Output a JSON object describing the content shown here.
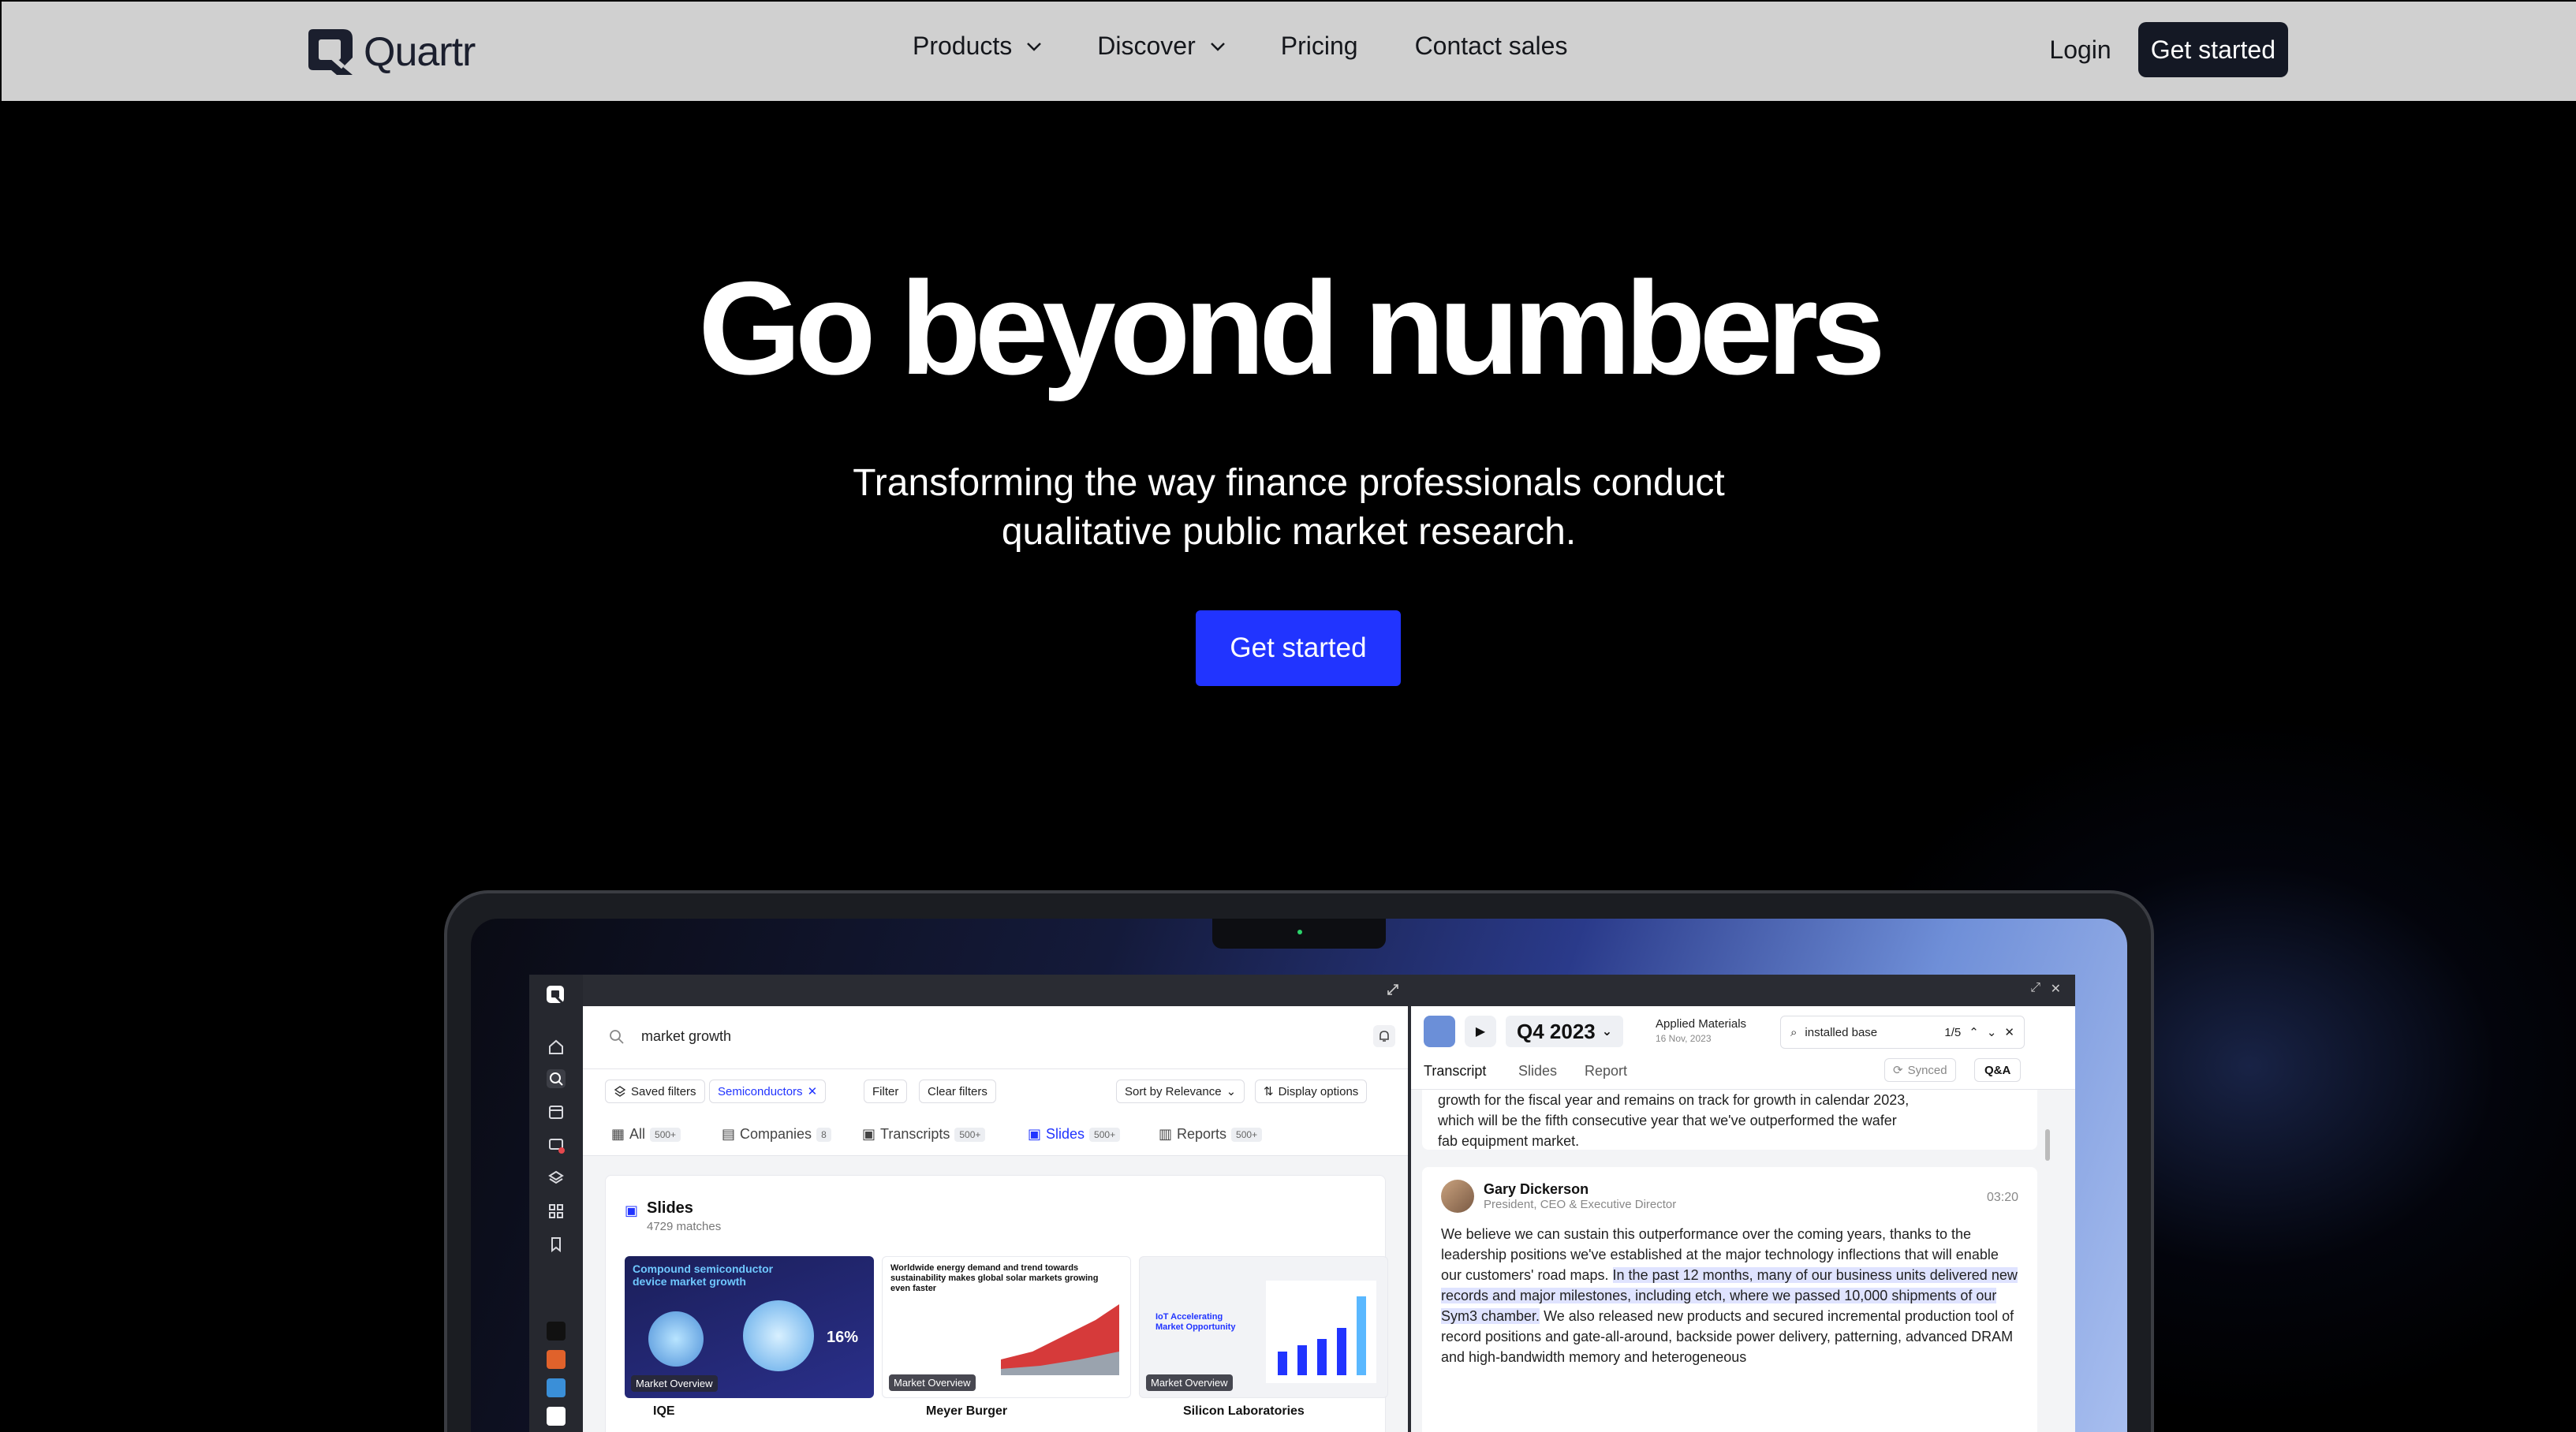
{
  "nav": {
    "logo_text": "Quartr",
    "links": [
      {
        "label": "Products",
        "has_dropdown": true
      },
      {
        "label": "Discover",
        "has_dropdown": true
      },
      {
        "label": "Pricing",
        "has_dropdown": false
      },
      {
        "label": "Contact sales",
        "has_dropdown": false
      }
    ],
    "login": "Login",
    "cta": "Get started"
  },
  "hero": {
    "title": "Go beyond numbers",
    "subtitle_line1": "Transforming the way finance professionals conduct",
    "subtitle_line2": "qualitative public market research.",
    "cta": "Get started"
  },
  "app": {
    "search": {
      "query": "market growth"
    },
    "filters": {
      "saved": "Saved filters",
      "active_filter": "Semiconductors",
      "filter": "Filter",
      "clear": "Clear filters",
      "sort": "Sort by Relevance",
      "display": "Display options"
    },
    "tabs": [
      {
        "label": "All",
        "count": "500+"
      },
      {
        "label": "Companies",
        "count": "8"
      },
      {
        "label": "Transcripts",
        "count": "500+"
      },
      {
        "label": "Slides",
        "count": "500+"
      },
      {
        "label": "Reports",
        "count": "500+"
      }
    ],
    "results": {
      "title": "Slides",
      "matches": "4729 matches",
      "cards": [
        {
          "heading": "Compound semiconductor device market growth",
          "stat": "16%",
          "badge": "Market Overview",
          "company": "IQE"
        },
        {
          "heading": "Worldwide energy demand and trend towards sustainability makes global solar markets growing even faster",
          "badge": "Market Overview",
          "company": "Meyer Burger"
        },
        {
          "heading": "IoT Accelerating Market Opportunity",
          "badge": "Market Overview",
          "company": "Silicon Laboratories"
        }
      ]
    },
    "transcript": {
      "quarter": "Q4 2023",
      "company": "Applied Materials",
      "date": "16 Nov, 2023",
      "find_query": "installed base",
      "find_count": "1/5",
      "tabs": [
        "Transcript",
        "Slides",
        "Report"
      ],
      "synced": "Synced",
      "qa": "Q&A",
      "prev_text_1": "growth for the fiscal year and remains on track for growth in calendar 2023,",
      "prev_text_2": "which will be the fifth consecutive year that we've outperformed the wafer",
      "prev_text_3": "fab equipment market.",
      "speaker": "Gary Dickerson",
      "role": "President, CEO & Executive Director",
      "time": "03:20",
      "para_a": "We believe we can sustain this outperformance over the coming years, thanks to the leadership positions we've established at the major technology inflections that will enable our customers' road maps.",
      "para_hl": "In the past 12 months, many of our business units delivered new records and major milestones, including etch, where we passed 10,000 shipments of our Sym3 chamber.",
      "para_b": "We also released new products and secured incremental production tool of record positions and gate-all-around, backside power delivery, patterning, advanced DRAM and high-bandwidth memory and heterogeneous"
    }
  },
  "colors": {
    "accent": "#2134ff",
    "nav_bg": "#d0d0d0",
    "dark_button": "#141824"
  }
}
